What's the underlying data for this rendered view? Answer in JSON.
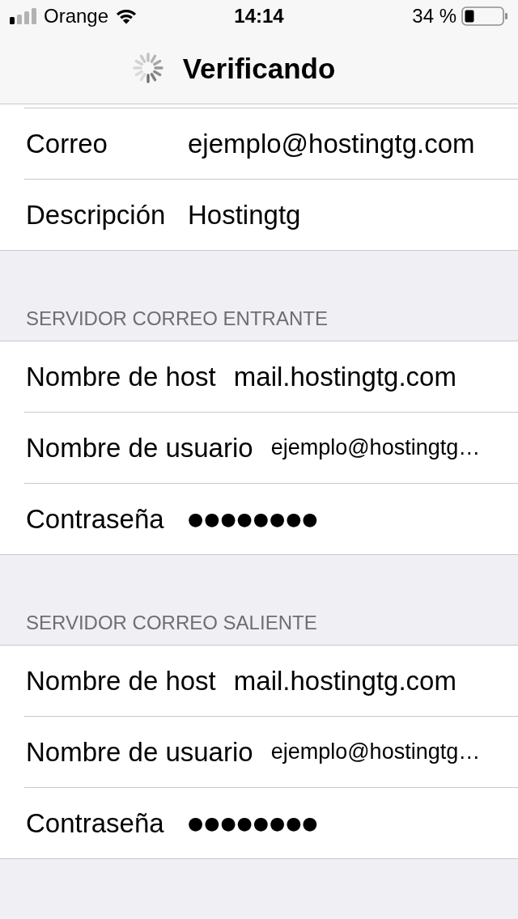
{
  "status_bar": {
    "carrier": "Orange",
    "time": "14:14",
    "battery": "34 %"
  },
  "nav_bar": {
    "title": "Verificando",
    "loading": true
  },
  "sections": [
    {
      "rows": [
        {
          "kind": "text",
          "label": "Correo",
          "value": "ejemplo@hostingtg.com"
        },
        {
          "kind": "text",
          "label": "Descripción",
          "value": "Hostingtg"
        }
      ]
    },
    {
      "header": "SERVIDOR CORREO ENTRANTE",
      "rows": [
        {
          "kind": "text",
          "label": "Nombre de host",
          "value": "mail.hostingtg.com"
        },
        {
          "kind": "compact",
          "label": "Nombre de usuario",
          "value": "ejemplo@hostingtg…"
        },
        {
          "kind": "password",
          "label": "Contraseña",
          "value": "●●●●●●●●"
        }
      ]
    },
    {
      "header": "SERVIDOR CORREO SALIENTE",
      "rows": [
        {
          "kind": "text",
          "label": "Nombre de host",
          "value": "mail.hostingtg.com"
        },
        {
          "kind": "compact",
          "label": "Nombre de usuario",
          "value": "ejemplo@hostingtg…"
        },
        {
          "kind": "password",
          "label": "Contraseña",
          "value": "●●●●●●●●"
        }
      ]
    }
  ]
}
